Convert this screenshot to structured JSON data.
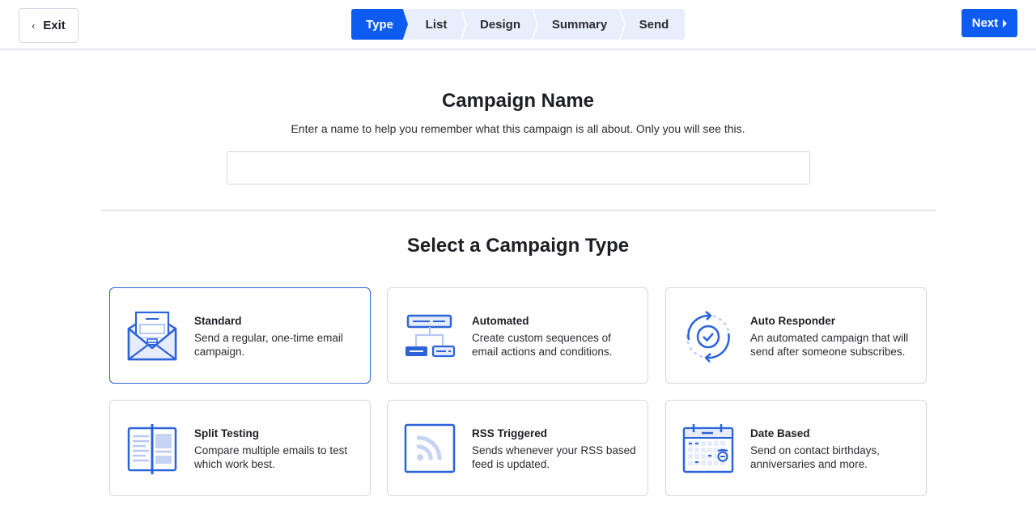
{
  "header": {
    "exit_label": "Exit",
    "next_label": "Next",
    "steps": [
      {
        "label": "Type",
        "active": true
      },
      {
        "label": "List",
        "active": false
      },
      {
        "label": "Design",
        "active": false
      },
      {
        "label": "Summary",
        "active": false
      },
      {
        "label": "Send",
        "active": false
      }
    ]
  },
  "campaign_name": {
    "title": "Campaign Name",
    "description": "Enter a name to help you remember what this campaign is all about. Only you will see this.",
    "value": "",
    "placeholder": ""
  },
  "campaign_type": {
    "title": "Select a Campaign Type",
    "selected": "Standard",
    "options": [
      {
        "title": "Standard",
        "description": "Send a regular, one-time email campaign.",
        "icon": "envelope-icon"
      },
      {
        "title": "Automated",
        "description": "Create custom sequences of email actions and conditions.",
        "icon": "workflow-icon"
      },
      {
        "title": "Auto Responder",
        "description": "An automated campaign that will send after someone subscribes.",
        "icon": "cycle-check-icon"
      },
      {
        "title": "Split Testing",
        "description": "Compare multiple emails to test which work best.",
        "icon": "split-page-icon"
      },
      {
        "title": "RSS Triggered",
        "description": "Sends whenever your RSS based feed is updated.",
        "icon": "rss-icon"
      },
      {
        "title": "Date Based",
        "description": "Send on contact birthdays, anniversaries and more.",
        "icon": "calendar-icon"
      }
    ]
  },
  "colors": {
    "accent": "#0c5cf2",
    "icon_blue": "#2d63d8",
    "icon_fill": "#e6ecfb",
    "step_bg": "#e8eefc"
  }
}
